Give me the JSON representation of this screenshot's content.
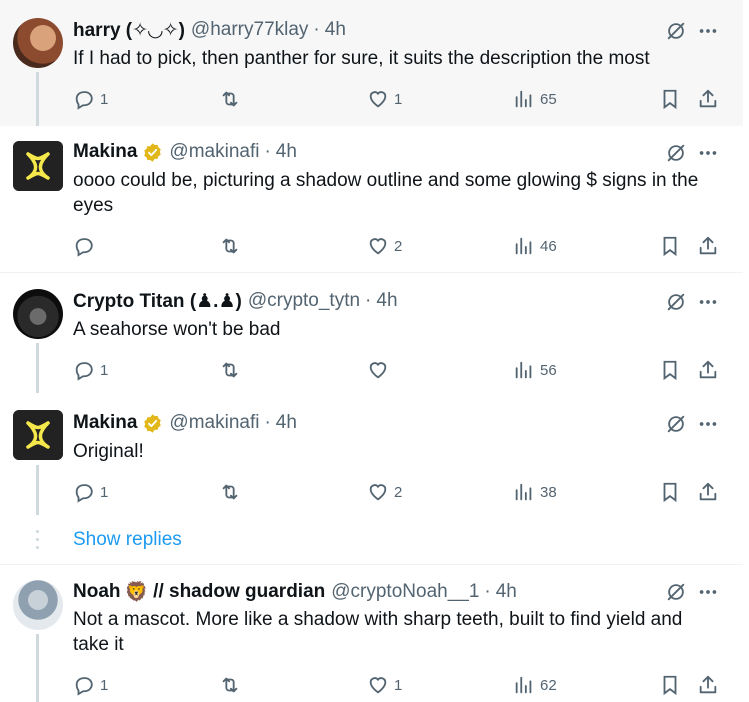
{
  "posts": [
    {
      "name": "harry (✧◡✧)",
      "handle": "@harry77klay",
      "time": "4h",
      "text": "If I had to pick, then panther for sure, it suits the description the most",
      "replies": "1",
      "reposts": "",
      "likes": "1",
      "views": "65"
    },
    {
      "name": "Makina",
      "handle": "@makinafi",
      "time": "4h",
      "text_line1": "oooo could be, picturing a shadow outline and some  glowing $ signs in the",
      "text_line2": "eyes",
      "replies": "",
      "reposts": "",
      "likes": "2",
      "views": "46"
    },
    {
      "name": "Crypto Titan (♟.♟)",
      "handle": "@crypto_tytn",
      "time": "4h",
      "text": "A seahorse won't be bad",
      "replies": "1",
      "reposts": "",
      "likes": "",
      "views": "56"
    },
    {
      "name": "Makina",
      "handle": "@makinafi",
      "time": "4h",
      "text": "Original!",
      "replies": "1",
      "reposts": "",
      "likes": "2",
      "views": "38"
    },
    {
      "name_prefix": "Noah",
      "name_suffix": "// shadow guardian",
      "handle": "@cryptoNoah__1",
      "time": "4h",
      "text_line1": "Not a mascot. More like a shadow with sharp teeth, built to find yield and",
      "text_line2": "take it",
      "replies": "1",
      "reposts": "",
      "likes": "1",
      "views": "62"
    }
  ],
  "show_replies": "Show replies",
  "emoji_lion": "🦁",
  "separator": "·",
  "colors": {
    "accent": "#1d9bf0",
    "muted": "#536471",
    "verified": "#e2b719",
    "makina_logo": "#f5e84a"
  },
  "icons": [
    "reply-icon",
    "repost-icon",
    "like-icon",
    "views-icon",
    "bookmark-icon",
    "share-icon",
    "grok-icon",
    "more-icon",
    "verified-badge-icon"
  ]
}
